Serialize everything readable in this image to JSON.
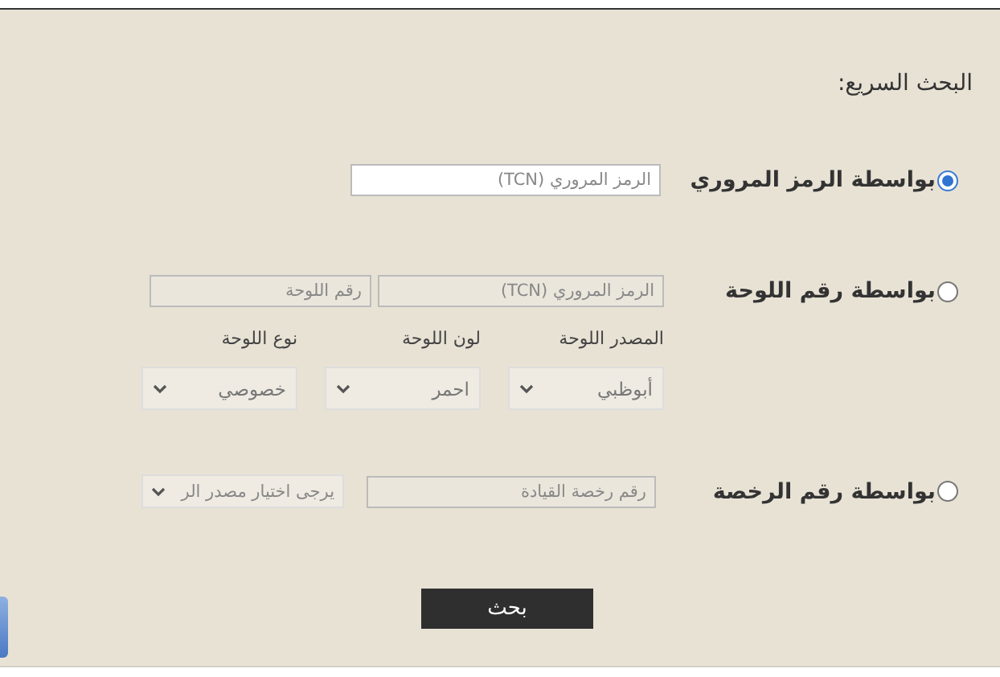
{
  "title": "البحث السريع:",
  "options": [
    {
      "kind": "tcn",
      "label": "بواسطة الرمز المروري",
      "selected": true,
      "disabled": false,
      "fields": [
        {
          "kind": "input",
          "placeholder": "الرمز المروري (TCN)"
        }
      ]
    },
    {
      "kind": "plate",
      "label": "بواسطة رقم اللوحة",
      "selected": false,
      "disabled": true,
      "fields": [
        {
          "kind": "input",
          "placeholder": "الرمز المروري (TCN)"
        },
        {
          "kind": "input",
          "placeholder": "رقم اللوحة"
        }
      ],
      "dropdowns": [
        {
          "label": "المصدر اللوحة",
          "value": "أبوظبي"
        },
        {
          "label": "لون اللوحة",
          "value": "احمر"
        },
        {
          "label": "نوع اللوحة",
          "value": "خصوصي"
        }
      ]
    },
    {
      "kind": "license",
      "label": "بواسطة رقم الرخصة",
      "selected": false,
      "disabled": true,
      "fields": [
        {
          "kind": "input",
          "placeholder": "رقم رخصة القيادة"
        },
        {
          "kind": "dropdown",
          "value": "يرجى اختيار مصدر الر"
        }
      ]
    }
  ],
  "search_button": "بحث"
}
